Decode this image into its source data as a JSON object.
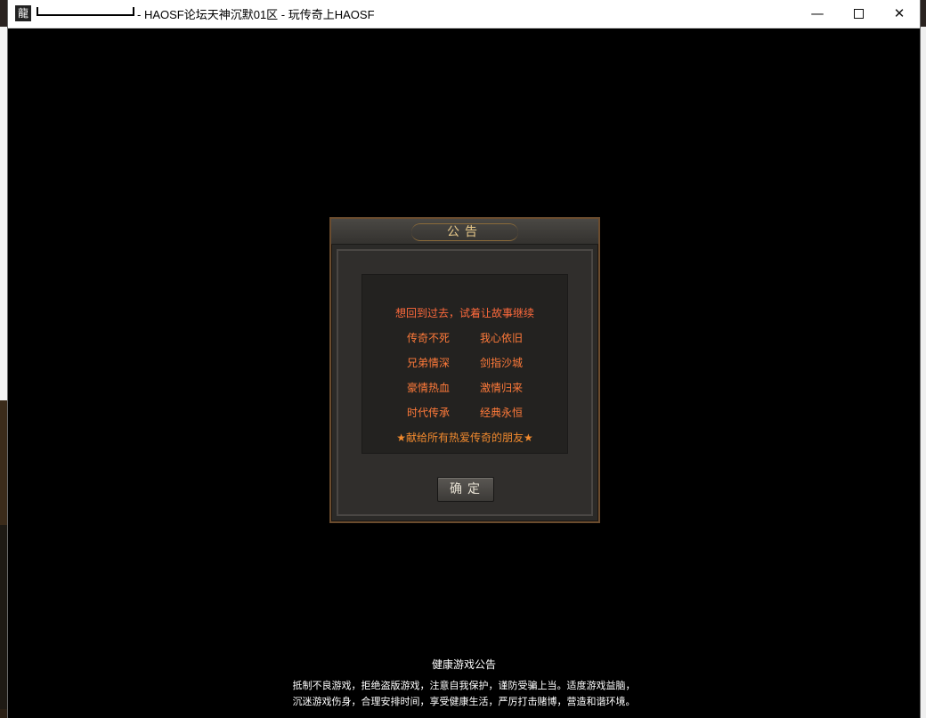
{
  "window": {
    "app_icon": "龍",
    "title": "- HAOSF论坛天神沉默01区 - 玩传奇上HAOSF",
    "minimize": "—",
    "close": "✕"
  },
  "dialog": {
    "title": "公告",
    "faded_line": "",
    "headline": "想回到过去，试着让故事继续",
    "pairs": [
      [
        "传奇不死",
        "我心依旧"
      ],
      [
        "兄弟情深",
        "剑指沙城"
      ],
      [
        "豪情热血",
        "激情归来"
      ],
      [
        "时代传承",
        "经典永恒"
      ]
    ],
    "dedication": "★献给所有热爱传奇的朋友★",
    "confirm_label": "确定"
  },
  "health_notice": {
    "title": "健康游戏公告",
    "line1": "抵制不良游戏，拒绝盗版游戏，注意自我保护，谨防受骗上当。适度游戏益脑，",
    "line2": "沉迷游戏伤身，合理安排时间，享受健康生活，严厉打击赌博，营造和谐环境。"
  }
}
